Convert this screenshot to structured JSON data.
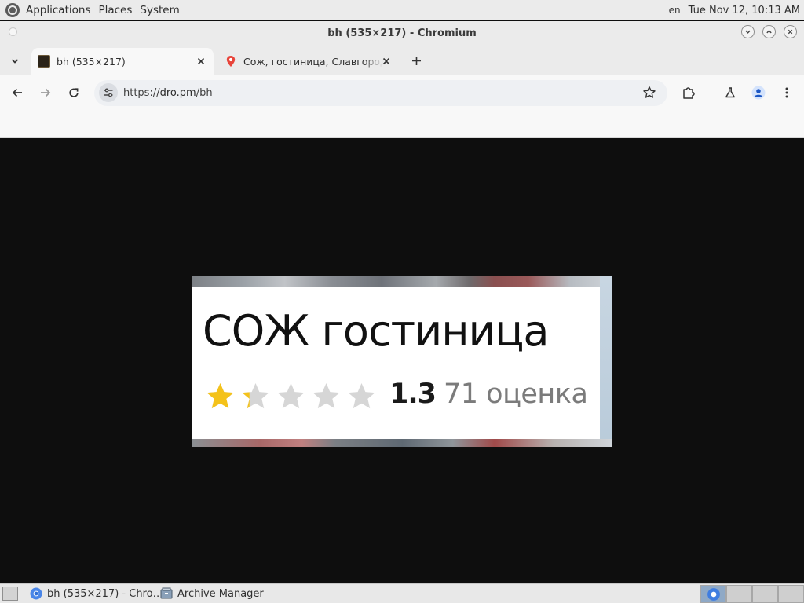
{
  "top_panel": {
    "menus": [
      "Applications",
      "Places",
      "System"
    ],
    "lang": "en",
    "clock": "Tue Nov 12, 10:13 AM"
  },
  "window": {
    "title": "bh (535×217) - Chromium"
  },
  "tabs": [
    {
      "label": "bh (535×217)",
      "active": true,
      "icon": "image-favicon"
    },
    {
      "label": "Сож, гостиница, Славгород",
      "active": false,
      "icon": "map-pin-favicon"
    }
  ],
  "toolbar": {
    "url_prefix": "https://",
    "url_host": "dro.pm",
    "url_path": "/bh"
  },
  "page_image": {
    "hotel_name": "СОЖ гостиница",
    "rating_value": "1.3",
    "rating_count": "71 оценка",
    "rating_stars": 1.3,
    "max_stars": 5,
    "star_filled_color": "#f4c21a",
    "star_empty_color": "#d6d6d6"
  },
  "taskbar": {
    "items": [
      {
        "label": "bh (535×217) - Chro…",
        "icon": "chromium-icon"
      },
      {
        "label": "Archive Manager",
        "icon": "archive-manager-icon"
      }
    ]
  },
  "colors": {
    "panel_bg": "#ebebeb",
    "content_bg": "#0e0e0e"
  }
}
